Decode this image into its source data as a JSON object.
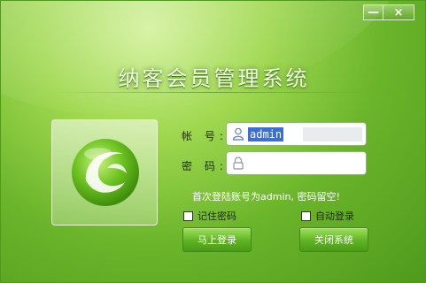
{
  "window": {
    "minimize_glyph": "—",
    "close_glyph": "×"
  },
  "app": {
    "title": "纳客会员管理系统"
  },
  "form": {
    "account_label": "帐 号:",
    "account_value": "admin",
    "password_label": "密 码:",
    "password_value": "",
    "hint": "首次登陆账号为admin, 密码留空!",
    "remember_label": "记住密码",
    "auto_login_label": "自动登录",
    "login_button": "马上登录",
    "close_button": "关闭系统"
  },
  "colors": {
    "brand_green": "#6bb52b",
    "selection_blue": "#3d6fd1"
  },
  "icons": {
    "logo": "green-swirl-logo",
    "account": "user-icon",
    "password": "lock-icon"
  }
}
